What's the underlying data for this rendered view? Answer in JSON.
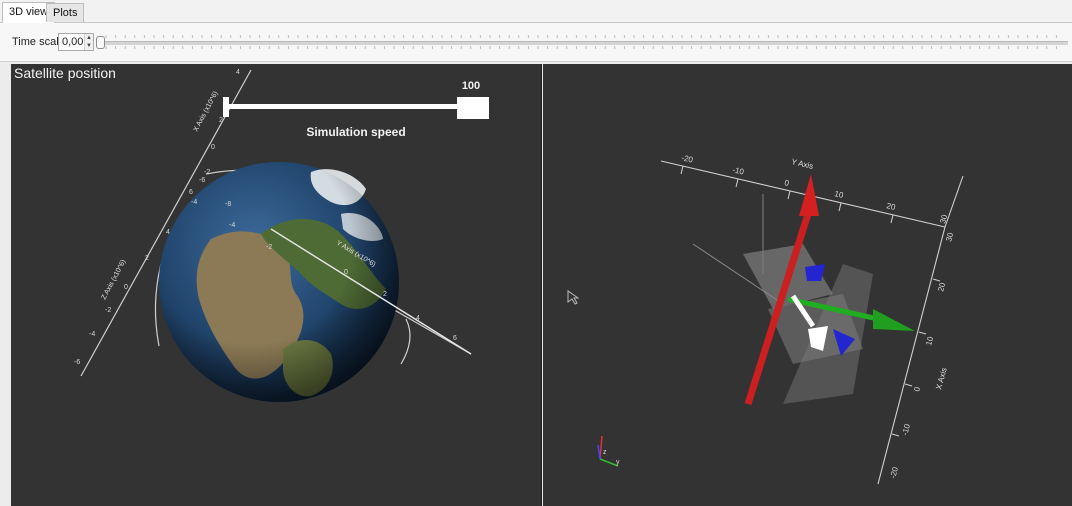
{
  "tabs": [
    {
      "label": "3D view",
      "active": true
    },
    {
      "label": "Plots",
      "active": false
    }
  ],
  "toolbar": {
    "time_scale_label": "Time scale",
    "time_scale_value": "0,00"
  },
  "left_view": {
    "title": "Satellite position",
    "slider_value": "100",
    "slider_label": "Simulation speed",
    "x_axis_label": "X Axis (x10^6)",
    "y_axis_label": "Y Axis (x10^6)",
    "z_axis_label": "Z Axis (x10^6)",
    "x_ticks": [
      "4",
      "2",
      "0",
      "-2",
      "-4",
      "-6",
      "-8"
    ],
    "y_ticks": [
      "-4",
      "-2",
      "0",
      "2",
      "4",
      "6"
    ],
    "z_ticks": [
      "-6",
      "-4",
      "-2",
      "0",
      "2",
      "4",
      "6"
    ]
  },
  "right_view": {
    "y_axis_label": "Y Axis",
    "x_axis_label": "X Axis",
    "y_ticks": [
      "-20",
      "-10",
      "0",
      "10",
      "20",
      "30"
    ],
    "x_ticks": [
      "30",
      "20",
      "10",
      "0",
      "-10",
      "-20"
    ],
    "orientation_labels": [
      "z",
      "y"
    ]
  },
  "colors": {
    "viewport_bg": "#333333",
    "arrow_x": "#cc1f1f",
    "arrow_y": "#1fae1f",
    "arrow_z": "#2326d0",
    "axis_lines": "#cfcfcf"
  }
}
